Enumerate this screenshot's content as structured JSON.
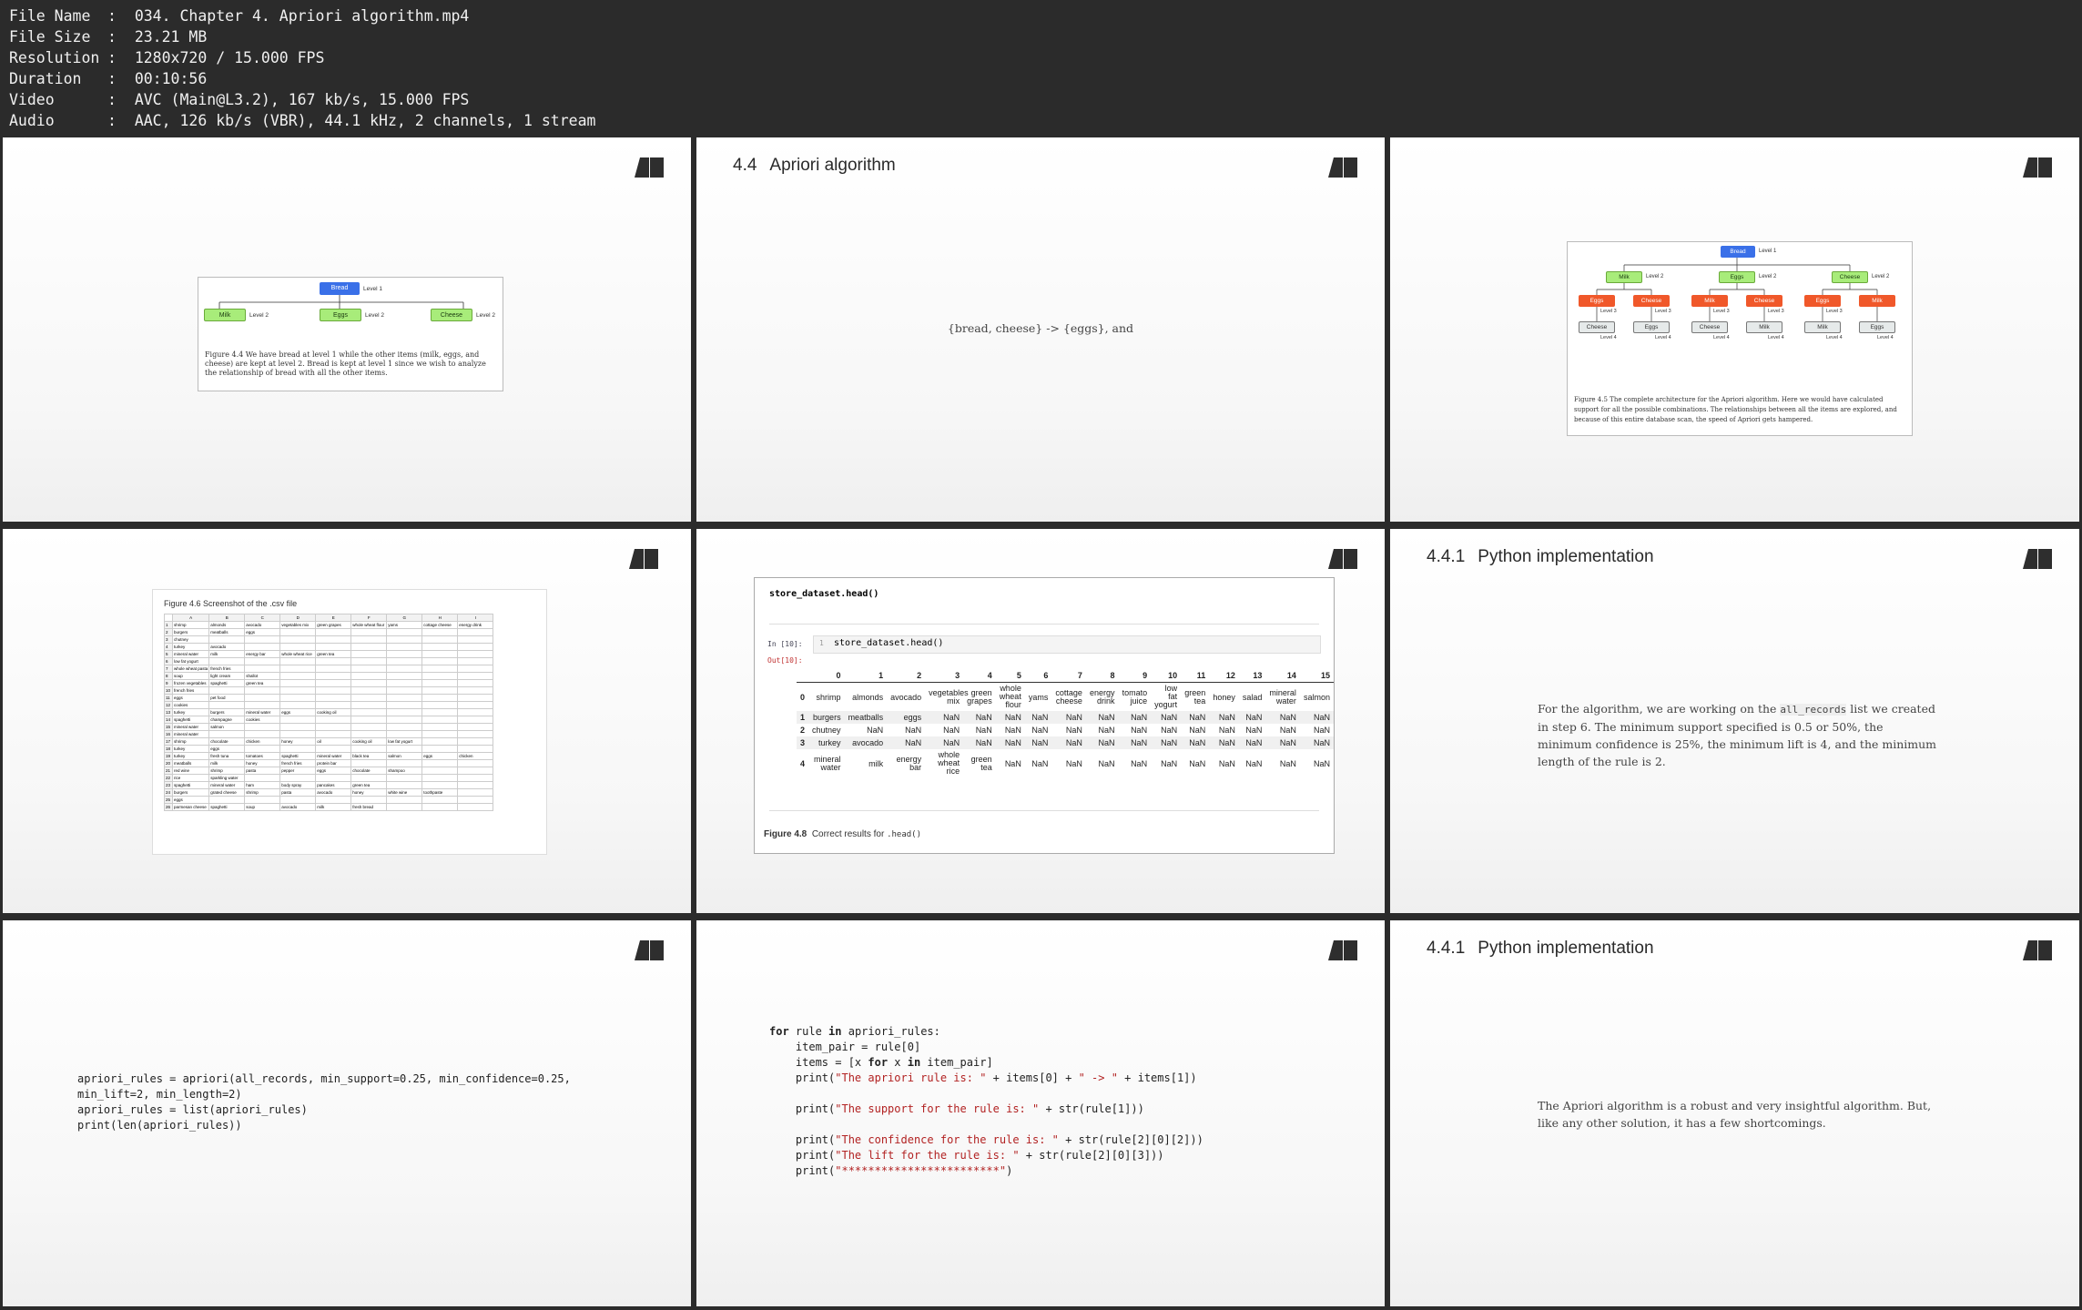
{
  "meta": [
    {
      "key": "File Name",
      "value": "034. Chapter 4. Apriori algorithm.mp4"
    },
    {
      "key": "File Size",
      "value": "23.21 MB"
    },
    {
      "key": "Resolution",
      "value": "1280x720 / 15.000 FPS"
    },
    {
      "key": "Duration",
      "value": "00:10:56"
    },
    {
      "key": "Video",
      "value": "AVC (Main@L3.2), 167 kb/s, 15.000 FPS"
    },
    {
      "key": "Audio",
      "value": "AAC, 126 kb/s (VBR), 44.1 kHz, 2 channels, 1 stream"
    }
  ],
  "colors": {
    "accent_blue": "#3a70e8",
    "node_green": "#a8ec7a",
    "node_red": "#f0582a",
    "string_red": "#b22222"
  },
  "thumb1": {
    "root": "Bread",
    "root_level": "Level 1",
    "children": [
      "Milk",
      "Eggs",
      "Cheese"
    ],
    "child_level": "Level 2",
    "caption": "Figure 4.4   We have bread at level 1 while the other items (milk, eggs, and cheese) are kept at level 2. Bread is kept at level 1 since we wish to analyze the relationship of bread with all the other items."
  },
  "thumb2": {
    "title_num": "4.4",
    "title": "Apriori algorithm",
    "text": "{bread, cheese} -> {eggs}, and"
  },
  "thumb3": {
    "root": "Bread",
    "level1": "Level 1",
    "level2": "Level 2",
    "level3": "Level 3",
    "level4": "Level 4",
    "l2": [
      "Milk",
      "Eggs",
      "Cheese"
    ],
    "l3": [
      "Eggs",
      "Cheese",
      "Milk",
      "Cheese",
      "Eggs",
      "Milk"
    ],
    "l4": [
      "Cheese",
      "Eggs",
      "Cheese",
      "Milk",
      "Milk",
      "Eggs"
    ],
    "caption": "Figure 4.5   The complete architecture for the Apriori algorithm. Here we would have calculated support for all the possible combinations. The relationships between all the items are explored, and because of this entire database scan, the speed of Apriori gets hampered."
  },
  "thumb4": {
    "caption": "Figure 4.6   Screenshot of the .csv file",
    "col_letters": [
      "A",
      "B",
      "C",
      "D",
      "E",
      "F",
      "G",
      "H",
      "I"
    ],
    "rows": [
      [
        "shrimp",
        "almonds",
        "avocado",
        "vegetables mix",
        "green grapes",
        "whole wheat flour",
        "yams",
        "cottage cheese",
        "energy drink"
      ],
      [
        "burgers",
        "meatballs",
        "eggs",
        "",
        "",
        "",
        "",
        "",
        ""
      ],
      [
        "chutney",
        "",
        "",
        "",
        "",
        "",
        "",
        "",
        ""
      ],
      [
        "turkey",
        "avocado",
        "",
        "",
        "",
        "",
        "",
        "",
        ""
      ],
      [
        "mineral water",
        "milk",
        "energy bar",
        "whole wheat rice",
        "green tea",
        "",
        "",
        "",
        ""
      ],
      [
        "low fat yogurt",
        "",
        "",
        "",
        "",
        "",
        "",
        "",
        ""
      ],
      [
        "whole wheat pasta",
        "french fries",
        "",
        "",
        "",
        "",
        "",
        "",
        ""
      ],
      [
        "soup",
        "light cream",
        "shallot",
        "",
        "",
        "",
        "",
        "",
        ""
      ],
      [
        "frozen vegetables",
        "spaghetti",
        "green tea",
        "",
        "",
        "",
        "",
        "",
        ""
      ],
      [
        "french fries",
        "",
        "",
        "",
        "",
        "",
        "",
        "",
        ""
      ],
      [
        "eggs",
        "pet food",
        "",
        "",
        "",
        "",
        "",
        "",
        ""
      ],
      [
        "cookies",
        "",
        "",
        "",
        "",
        "",
        "",
        "",
        ""
      ],
      [
        "turkey",
        "burgers",
        "mineral water",
        "eggs",
        "cooking oil",
        "",
        "",
        "",
        ""
      ],
      [
        "spaghetti",
        "champagne",
        "cookies",
        "",
        "",
        "",
        "",
        "",
        ""
      ],
      [
        "mineral water",
        "salmon",
        "",
        "",
        "",
        "",
        "",
        "",
        ""
      ],
      [
        "mineral water",
        "",
        "",
        "",
        "",
        "",
        "",
        "",
        ""
      ],
      [
        "shrimp",
        "chocolate",
        "chicken",
        "honey",
        "oil",
        "cooking oil",
        "low fat yogurt",
        "",
        ""
      ],
      [
        "turkey",
        "eggs",
        "",
        "",
        "",
        "",
        "",
        "",
        ""
      ],
      [
        "turkey",
        "fresh tuna",
        "tomatoes",
        "spaghetti",
        "mineral water",
        "black tea",
        "salmon",
        "eggs",
        "chicken"
      ],
      [
        "meatballs",
        "milk",
        "honey",
        "french fries",
        "protein bar",
        "",
        "",
        "",
        ""
      ],
      [
        "red wine",
        "shrimp",
        "pasta",
        "pepper",
        "eggs",
        "chocolate",
        "shampoo",
        "",
        ""
      ],
      [
        "rice",
        "sparkling water",
        "",
        "",
        "",
        "",
        "",
        "",
        ""
      ],
      [
        "spaghetti",
        "mineral water",
        "ham",
        "body spray",
        "pancakes",
        "green tea",
        "",
        "",
        ""
      ],
      [
        "burgers",
        "grated cheese",
        "shrimp",
        "pasta",
        "avocado",
        "honey",
        "white wine",
        "toothpaste",
        ""
      ],
      [
        "eggs",
        "",
        "",
        "",
        "",
        "",
        "",
        "",
        ""
      ],
      [
        "parmesan cheese",
        "spaghetti",
        "soup",
        "avocado",
        "milk",
        "fresh bread",
        "",
        "",
        ""
      ]
    ]
  },
  "thumb5": {
    "code_title": "store_dataset.head()",
    "in_prompt": "In [10]:",
    "out_prompt": "Out[10]:",
    "line_no": "1",
    "cell_code": "store_dataset.head()",
    "columns": [
      "0",
      "1",
      "2",
      "3",
      "4",
      "5",
      "6",
      "7",
      "8",
      "9",
      "10",
      "11",
      "12",
      "13",
      "14",
      "15"
    ],
    "rows": [
      {
        "idx": "0",
        "cells": [
          "shrimp",
          "almonds",
          "avocado",
          "vegetables mix",
          "green grapes",
          "whole wheat flour",
          "yams",
          "cottage cheese",
          "energy drink",
          "tomato juice",
          "low fat yogurt",
          "green tea",
          "honey",
          "salad",
          "mineral water",
          "salmon"
        ]
      },
      {
        "idx": "1",
        "cells": [
          "burgers",
          "meatballs",
          "eggs",
          "NaN",
          "NaN",
          "NaN",
          "NaN",
          "NaN",
          "NaN",
          "NaN",
          "NaN",
          "NaN",
          "NaN",
          "NaN",
          "NaN",
          "NaN"
        ]
      },
      {
        "idx": "2",
        "cells": [
          "chutney",
          "NaN",
          "NaN",
          "NaN",
          "NaN",
          "NaN",
          "NaN",
          "NaN",
          "NaN",
          "NaN",
          "NaN",
          "NaN",
          "NaN",
          "NaN",
          "NaN",
          "NaN"
        ]
      },
      {
        "idx": "3",
        "cells": [
          "turkey",
          "avocado",
          "NaN",
          "NaN",
          "NaN",
          "NaN",
          "NaN",
          "NaN",
          "NaN",
          "NaN",
          "NaN",
          "NaN",
          "NaN",
          "NaN",
          "NaN",
          "NaN"
        ]
      },
      {
        "idx": "4",
        "cells": [
          "mineral water",
          "milk",
          "energy bar",
          "whole wheat rice",
          "green tea",
          "NaN",
          "NaN",
          "NaN",
          "NaN",
          "NaN",
          "NaN",
          "NaN",
          "NaN",
          "NaN",
          "NaN",
          "NaN"
        ]
      }
    ],
    "caption_label": "Figure 4.8",
    "caption_text": "Correct results for",
    "caption_code": ".head()"
  },
  "thumb6": {
    "title_num": "4.4.1",
    "title": "Python implementation",
    "text_before": "For the algorithm, we are working on the",
    "text_code": "all_records",
    "text_after": "list we created in step 6. The minimum support specified is 0.5 or 50%, the minimum confidence is 25%, the minimum lift is 4, and the minimum length of the rule is 2."
  },
  "thumb7": {
    "lines": [
      "apriori_rules = apriori(all_records, min_support=0.25, min_confidence=0.25,",
      "min_lift=2, min_length=2)",
      "apriori_rules = list(apriori_rules)",
      "print(len(apriori_rules))"
    ]
  },
  "thumb8": {
    "for_kw": "for",
    "for_rest": " rule ",
    "in_kw": "in",
    "for_end": " apriori_rules:",
    "line2": "    item_pair = rule[0]",
    "line3_a": "    items = [x ",
    "line3_for": "for",
    "line3_b": " x ",
    "line3_in": "in",
    "line3_c": " item_pair]",
    "p1_fn": "    print(",
    "p1_str": "\"The apriori rule is: \"",
    "p1_rest": " + items[0] + ",
    "p1_str2": "\" -> \"",
    "p1_end": " + items[1])",
    "p2_fn": "    print(",
    "p2_str": "\"The support for the rule is: \"",
    "p2_end": " + str(rule[1]))",
    "p3_fn": "    print(",
    "p3_str": "\"The confidence for the rule is: \"",
    "p3_end": " + str(rule[2][0][2]))",
    "p4_fn": "    print(",
    "p4_str": "\"The lift for the rule is: \"",
    "p4_end": " + str(rule[2][0][3]))",
    "p5_fn": "    print(",
    "p5_str": "\"************************\"",
    "p5_end": ")"
  },
  "thumb9": {
    "title_num": "4.4.1",
    "title": "Python implementation",
    "text": "The Apriori algorithm is a robust and very insightful algorithm. But, like any other solution, it has a few shortcomings."
  }
}
